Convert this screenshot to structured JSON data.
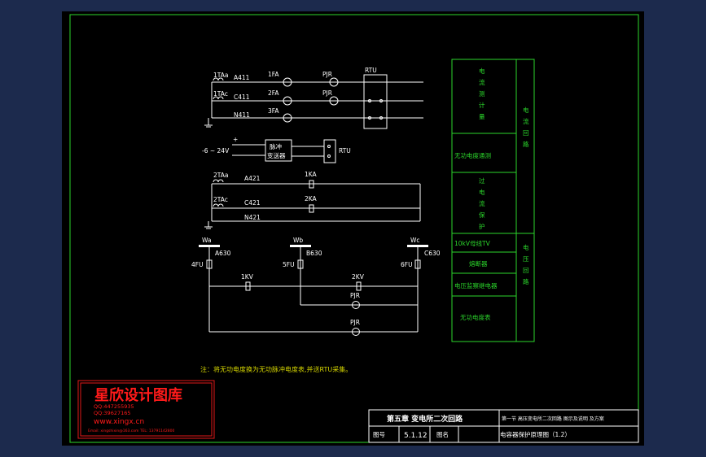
{
  "colors": {
    "background": "#1c2a4d",
    "sheet": "#000000",
    "wire": "#ffffff",
    "frame": "#2bd62b",
    "logo": "#e01818",
    "note": "#d4d400"
  },
  "circuit1": {
    "ct_a": "1TAa",
    "ct_c": "1TAc",
    "wire_a": "A411",
    "wire_c": "C411",
    "wire_n": "N411",
    "fa1": "1FA",
    "fa2": "2FA",
    "fa3": "3FA",
    "pjr1": "PJR",
    "pjr2": "PJR",
    "rtu": "RTU"
  },
  "circuit2": {
    "voltage": "-6 ~ 24V",
    "transmitter_line1": "脉冲",
    "transmitter_line2": "变送器",
    "rtu": "RTU"
  },
  "circuit3": {
    "ct_a": "2TAa",
    "ct_c": "2TAc",
    "wire_a": "A421",
    "wire_c": "C421",
    "wire_n": "N421",
    "ka1": "1KA",
    "ka2": "2KA"
  },
  "circuit4": {
    "bus_a": "Wa",
    "bus_b": "Wb",
    "bus_c": "Wc",
    "wire_a": "A630",
    "wire_b": "B630",
    "wire_c": "C630",
    "fu4": "4FU",
    "fu5": "5FU",
    "fu6": "6FU",
    "kv1": "1KV",
    "kv2": "2KV",
    "pjr1": "PJR",
    "pjr2": "PJR"
  },
  "legend": {
    "current_items": [
      "电流测计量",
      "无功电度通测",
      "过电流保护"
    ],
    "current_group": "电流回路",
    "voltage_items": [
      "10kV母线TV",
      "熔断器",
      "电压监察继电器",
      "无功电度表"
    ],
    "voltage_group": "电压回路"
  },
  "note": "注：将无功电度换为无功脉冲电度表,并送RTU采集。",
  "logo": {
    "title": "星欣设计图库",
    "qq1": "QQ:447255935",
    "qq2": "QQ:39627165",
    "website": "www.xingx.cn",
    "contact": "Email: xingshixin@163.com   TEL: 13791142800"
  },
  "title_block": {
    "chapter": "第五章 变电所二次回路",
    "section": "第一节 高压变电所二次回路 图示及说明 及方案",
    "drawing_no_label": "图号",
    "drawing_no": "5.1.12",
    "drawing_name_label": "图名",
    "drawing_name": "电容器保护原理图（1.2）"
  }
}
